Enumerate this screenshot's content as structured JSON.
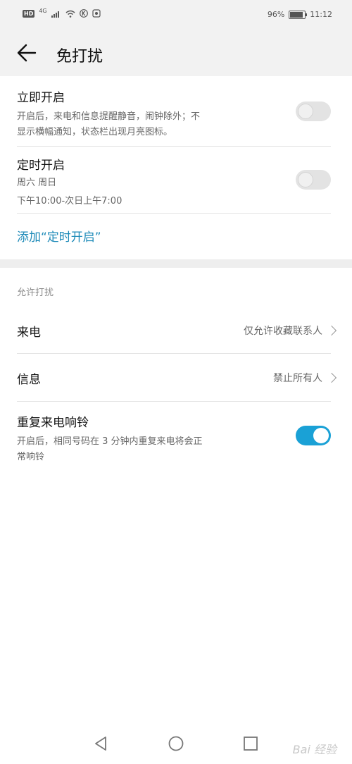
{
  "status": {
    "network_badge": "HD",
    "network_type": "4G",
    "battery_percent": "96%",
    "battery_level": 0.96,
    "time": "11:12"
  },
  "header": {
    "title": "免打扰"
  },
  "immediate": {
    "title": "立即开启",
    "desc_line1": "开启后，来电和信息提醒静音，闹钟除外；不",
    "desc_line2": "显示横幅通知，状态栏出现月亮图标。",
    "enabled": false
  },
  "scheduled": {
    "title": "定时开启",
    "days": "周六 周日",
    "time_range": "下午10:00-次日上午7:00",
    "enabled": false
  },
  "add_schedule": {
    "label": "添加“定时开启”"
  },
  "allow_section": {
    "label": "允许打扰",
    "calls": {
      "title": "来电",
      "value": "仅允许收藏联系人"
    },
    "messages": {
      "title": "信息",
      "value": "禁止所有人"
    },
    "repeat": {
      "title": "重复来电响铃",
      "desc_line1": "开启后，相同号码在 3 分钟内重复来电将会正",
      "desc_line2": "常响铃",
      "enabled": true
    }
  },
  "watermark": "Bai 经验",
  "colors": {
    "accent": "#1aa1d6",
    "link": "#1d8ab8",
    "toggle_off": "#e3e3e3"
  },
  "icons": {
    "back": "back-arrow-icon",
    "nav_back": "triangle-back-icon",
    "nav_home": "circle-home-icon",
    "nav_recents": "square-recents-icon"
  }
}
